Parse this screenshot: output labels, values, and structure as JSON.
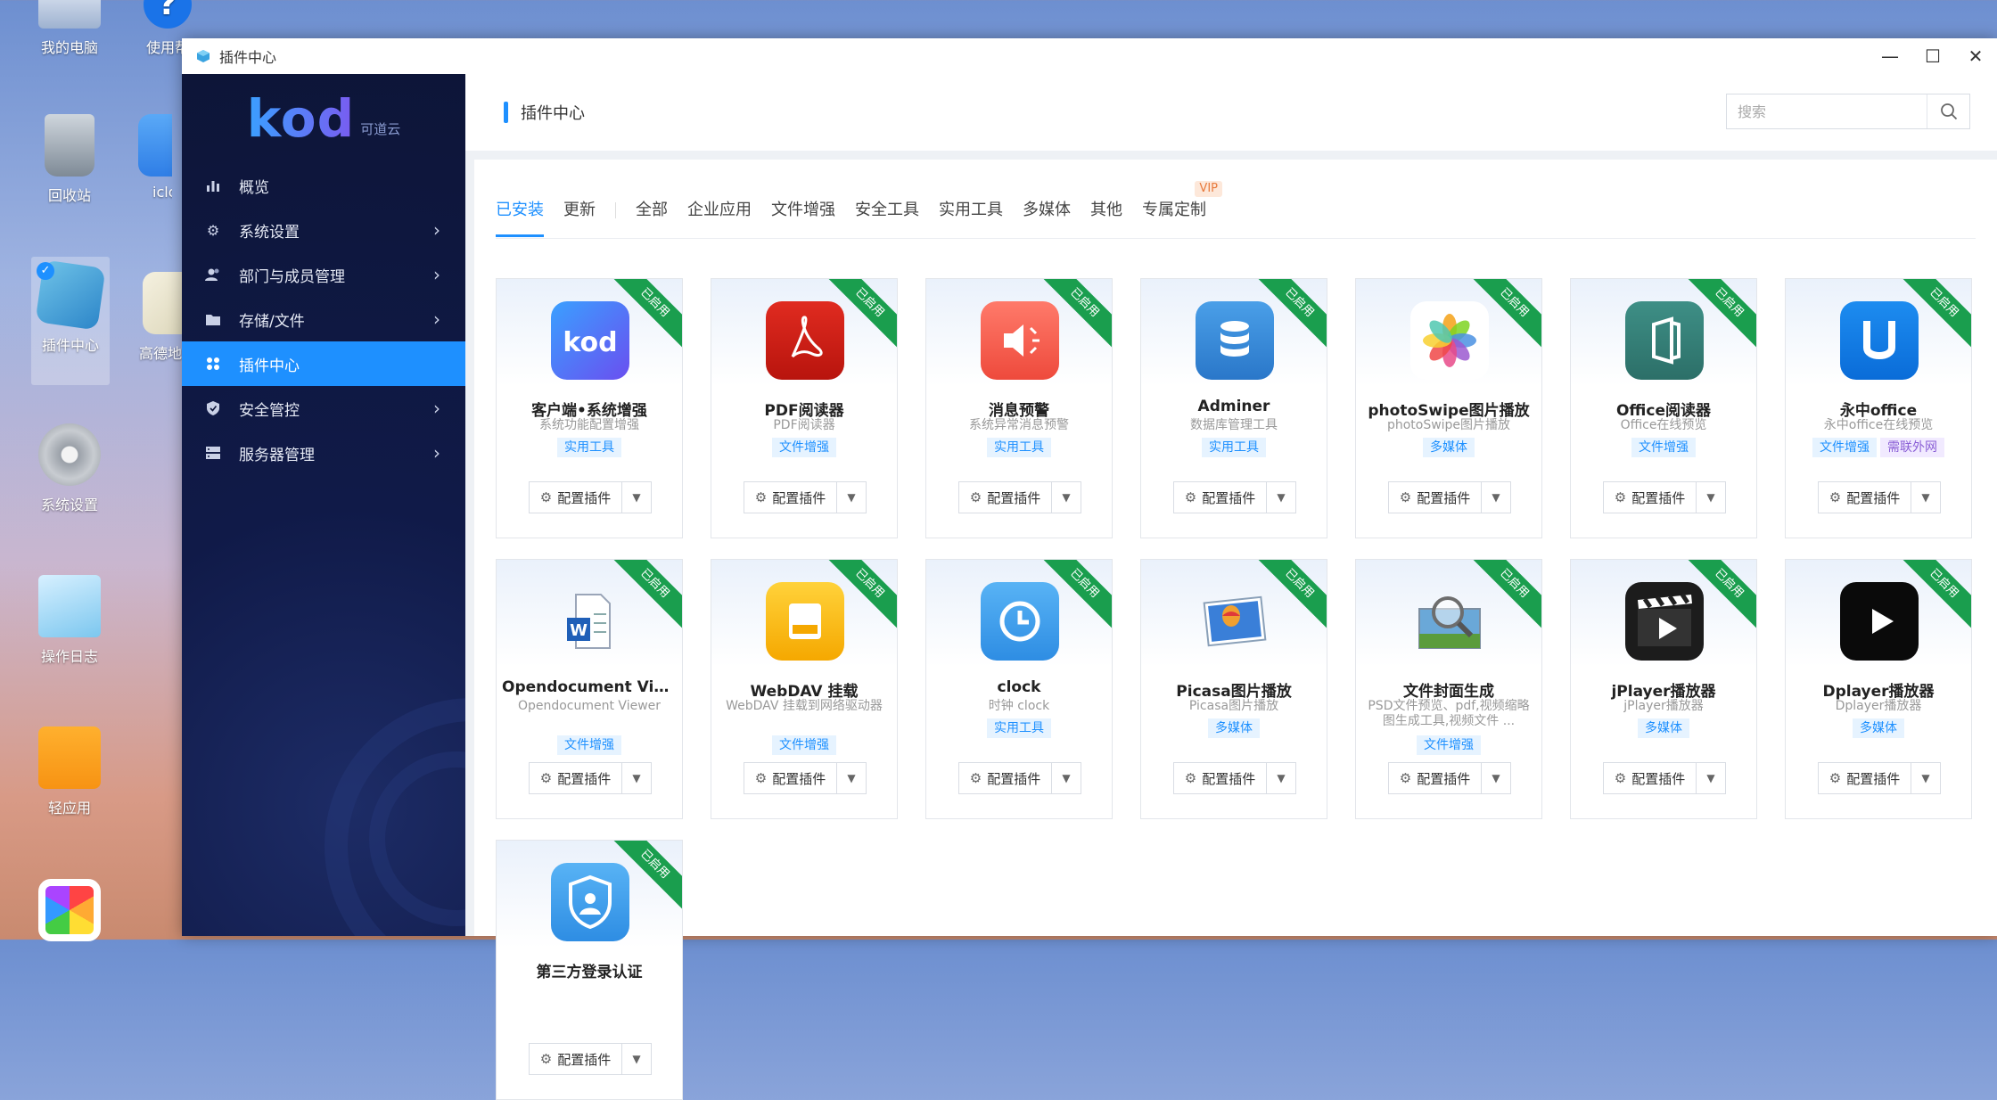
{
  "desktop": {
    "icons": [
      {
        "label": "我的电脑"
      },
      {
        "label": "使用帮"
      },
      {
        "label": "回收站"
      },
      {
        "label": "iclou"
      },
      {
        "label": "插件中心"
      },
      {
        "label": "高德地"
      },
      {
        "label": "系统设置"
      },
      {
        "label": "操作日志"
      },
      {
        "label": "轻应用"
      }
    ]
  },
  "window": {
    "title": "插件中心",
    "controls": {
      "minimize": "—",
      "maximize": "☐",
      "close": "✕"
    }
  },
  "sidebar": {
    "logo": "kod",
    "logo_sub": "可道云",
    "items": [
      {
        "label": "概览",
        "icon": "chart-bar-icon"
      },
      {
        "label": "系统设置",
        "icon": "gear-icon"
      },
      {
        "label": "部门与成员管理",
        "icon": "users-icon"
      },
      {
        "label": "存储/文件",
        "icon": "folder-icon"
      },
      {
        "label": "插件中心",
        "icon": "apps-icon",
        "active": true
      },
      {
        "label": "安全管控",
        "icon": "shield-icon"
      },
      {
        "label": "服务器管理",
        "icon": "server-icon"
      }
    ]
  },
  "header": {
    "title": "插件中心",
    "search_placeholder": "搜索"
  },
  "tabs": {
    "installed": "已安装",
    "update": "更新",
    "all": "全部",
    "enterprise": "企业应用",
    "file": "文件增强",
    "security": "安全工具",
    "util": "实用工具",
    "media": "多媒体",
    "other": "其他",
    "custom": "专属定制",
    "vip": "VIP"
  },
  "plugins": [
    {
      "name": "客户端•系统增强",
      "desc": "系统功能配置增强",
      "tags": [
        "实用工具"
      ],
      "ribbon": "已启用",
      "config": "配置插件",
      "icon": "kod-client-icon"
    },
    {
      "name": "PDF阅读器",
      "desc": "PDF阅读器",
      "tags": [
        "文件增强"
      ],
      "ribbon": "已启用",
      "config": "配置插件",
      "icon": "pdf-icon"
    },
    {
      "name": "消息预警",
      "desc": "系统异常消息预警",
      "tags": [
        "实用工具"
      ],
      "ribbon": "已启用",
      "config": "配置插件",
      "icon": "alert-speaker-icon"
    },
    {
      "name": "Adminer",
      "desc": "数据库管理工具",
      "tags": [
        "实用工具"
      ],
      "ribbon": "已启用",
      "config": "配置插件",
      "icon": "database-icon"
    },
    {
      "name": "photoSwipe图片播放",
      "desc": "photoSwipe图片播放",
      "tags": [
        "多媒体"
      ],
      "ribbon": "已启用",
      "config": "配置插件",
      "icon": "photos-flower-icon"
    },
    {
      "name": "Office阅读器",
      "desc": "Office在线预览",
      "tags": [
        "文件增强"
      ],
      "ribbon": "已启用",
      "config": "配置插件",
      "icon": "office-icon"
    },
    {
      "name": "永中office",
      "desc": "永中office在线预览",
      "tags": [
        "文件增强",
        "需联外网"
      ],
      "ribbon": "已启用",
      "config": "配置插件",
      "icon": "yozo-office-icon"
    },
    {
      "name": "Opendocument Vie...",
      "desc": "Opendocument Viewer",
      "tags": [
        "文件增强"
      ],
      "ribbon": "已启用",
      "config": "配置插件",
      "icon": "word-document-icon"
    },
    {
      "name": "WebDAV 挂载",
      "desc": "WebDAV 挂载到网络驱动器",
      "tags": [
        "文件增强"
      ],
      "ribbon": "已启用",
      "config": "配置插件",
      "icon": "webdav-drive-icon"
    },
    {
      "name": "clock",
      "desc": "时钟 clock",
      "tags": [
        "实用工具"
      ],
      "ribbon": "已启用",
      "config": "配置插件",
      "icon": "clock-icon"
    },
    {
      "name": "Picasa图片播放",
      "desc": "Picasa图片播放",
      "tags": [
        "多媒体"
      ],
      "ribbon": "已启用",
      "config": "配置插件",
      "icon": "picasa-balloon-icon"
    },
    {
      "name": "文件封面生成",
      "desc": "PSD文件预览、pdf,视频缩略图生成工具,视频文件 ...",
      "tags": [
        "文件增强"
      ],
      "ribbon": "已启用",
      "config": "配置插件",
      "icon": "magnifier-photo-icon"
    },
    {
      "name": "jPlayer播放器",
      "desc": "jPlayer播放器",
      "tags": [
        "多媒体"
      ],
      "ribbon": "已启用",
      "config": "配置插件",
      "icon": "clapperboard-icon"
    },
    {
      "name": "Dplayer播放器",
      "desc": "Dplayer播放器",
      "tags": [
        "多媒体"
      ],
      "ribbon": "已启用",
      "config": "配置插件",
      "icon": "play-button-icon"
    },
    {
      "name": "第三方登录认证",
      "desc": "",
      "tags": [],
      "ribbon": "已启用",
      "config": "配置插件",
      "icon": "shield-user-icon"
    }
  ]
}
